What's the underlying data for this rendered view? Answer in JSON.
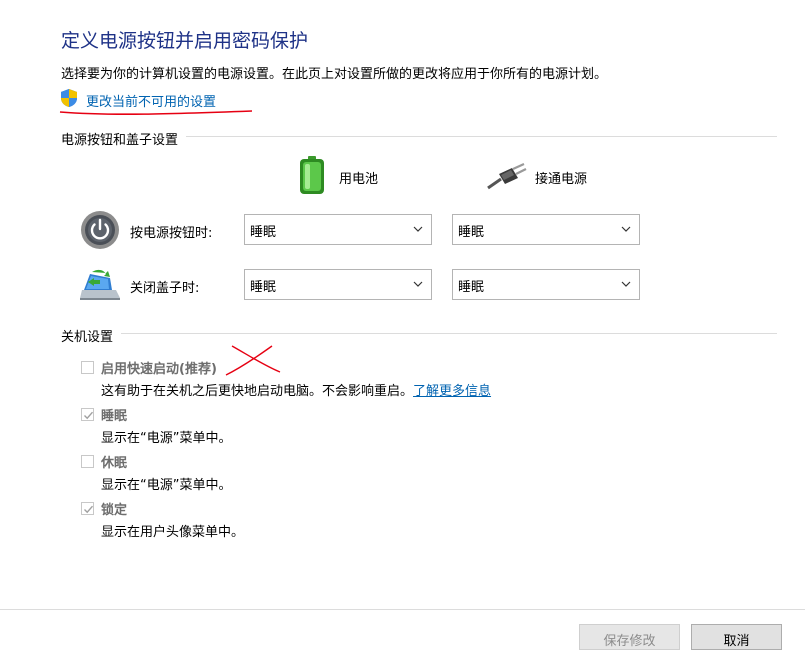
{
  "header": {
    "title": "定义电源按钮并启用密码保护",
    "description": "选择要为你的计算机设置的电源设置。在此页上对设置所做的更改将应用于你所有的电源计划。",
    "change_link": "更改当前不可用的设置",
    "shield_icon": "uac-shield-icon"
  },
  "power_section": {
    "label": "电源按钮和盖子设置",
    "columns": [
      {
        "label": "用电池",
        "icon": "battery-icon"
      },
      {
        "label": "接通电源",
        "icon": "power-plug-icon"
      }
    ],
    "rows": [
      {
        "label": "按电源按钮时:",
        "icon": "power-button-icon",
        "battery_value": "睡眠",
        "plugged_value": "睡眠"
      },
      {
        "label": "关闭盖子时:",
        "icon": "laptop-lid-icon",
        "battery_value": "睡眠",
        "plugged_value": "睡眠"
      }
    ]
  },
  "shutdown_section": {
    "label": "关机设置",
    "options": [
      {
        "label": "启用快速启动(推荐)",
        "checked": false,
        "desc": "这有助于在关机之后更快地启动电脑。不会影响重启。",
        "link": "了解更多信息"
      },
      {
        "label": "睡眠",
        "checked": true,
        "desc": "显示在“电源”菜单中。"
      },
      {
        "label": "休眠",
        "checked": false,
        "desc": "显示在“电源”菜单中。"
      },
      {
        "label": "锁定",
        "checked": true,
        "desc": "显示在用户头像菜单中。"
      }
    ]
  },
  "footer": {
    "save_label": "保存修改",
    "cancel_label": "取消"
  },
  "colors": {
    "title": "#1e3287",
    "link": "#0063b1",
    "annotation": "#e60012"
  }
}
